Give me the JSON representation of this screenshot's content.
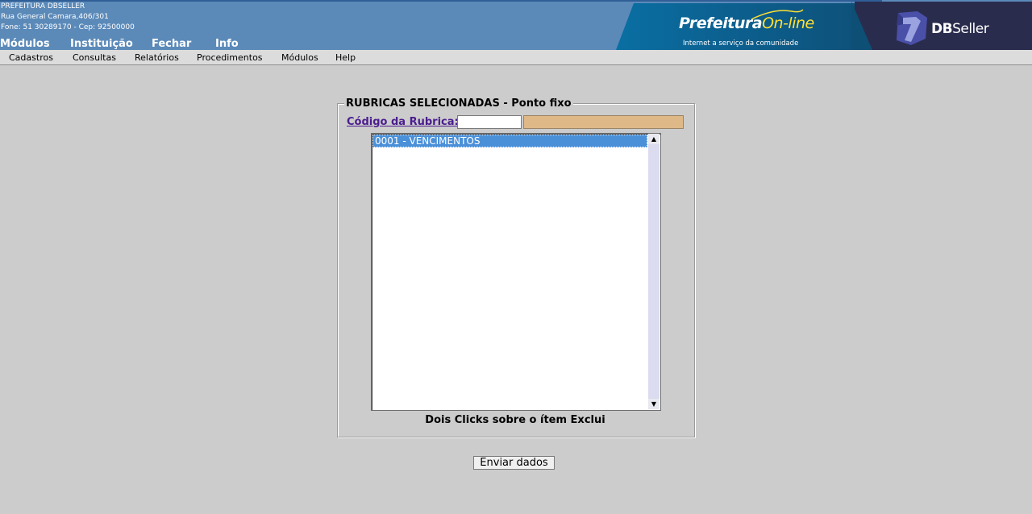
{
  "org": {
    "name": "PREFEITURA DBSELLER",
    "address": "Rua General Camara,406/301",
    "contact": "Fone: 51 30289170  -  Cep: 92500000"
  },
  "top_menu": [
    "Módulos",
    "Instituição",
    "Fechar",
    "Info"
  ],
  "banner": {
    "title_main": "Prefeitura",
    "title_accent": "On-line",
    "subtitle": "Internet a serviço da comunidade",
    "brand_bold": "DB",
    "brand_rest": "Seller"
  },
  "sub_menu": [
    "Cadastros",
    "Consultas",
    "Relatórios",
    "Procedimentos",
    "Módulos",
    "Help"
  ],
  "form": {
    "legend": "RUBRICAS SELECIONADAS - Ponto fixo",
    "code_label": "Código da Rubrica:",
    "code_value": "",
    "desc_value": "",
    "list_items": [
      "0001 - VENCIMENTOS"
    ],
    "hint": "Dois Clicks sobre o ítem Exclui",
    "submit_label": "Enviar dados"
  },
  "colors": {
    "header_bg": "#5b8ab9",
    "page_bg": "#cccccc",
    "selection": "#4a90d9",
    "link": "#4b1d8f",
    "desc_field_bg": "#deb887"
  }
}
